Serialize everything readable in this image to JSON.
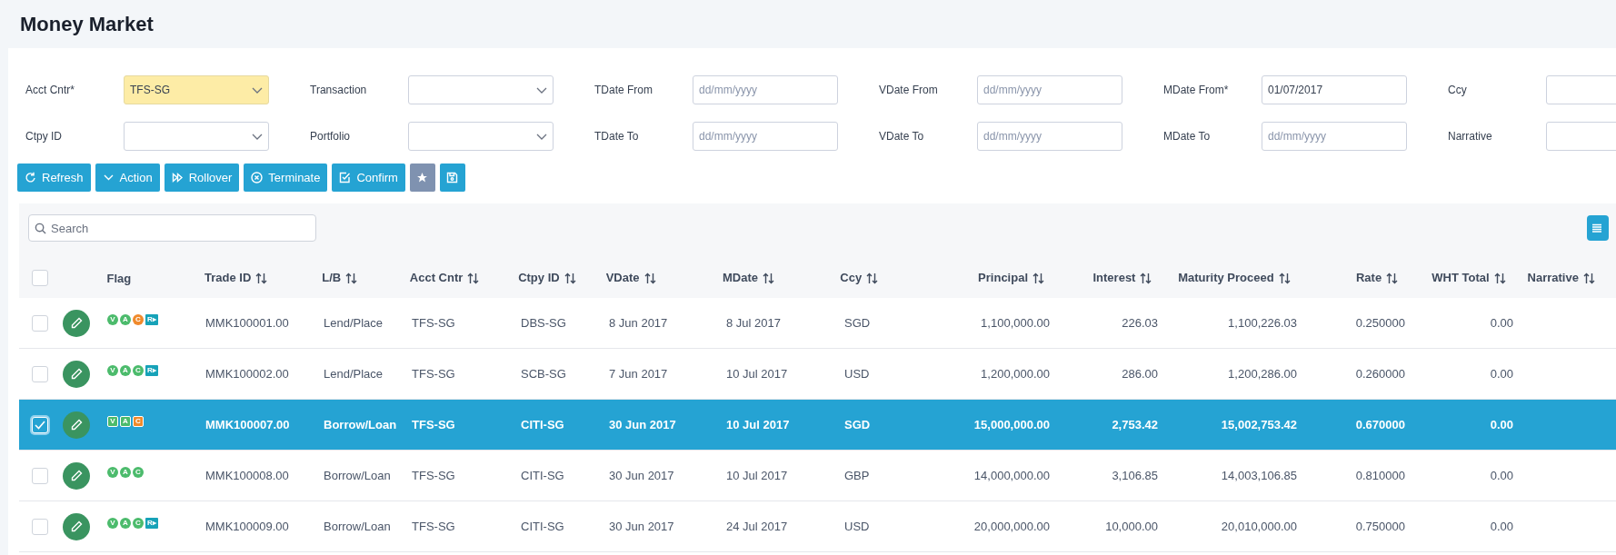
{
  "page_title": "Money Market",
  "filters": [
    {
      "label": "Acct Cntr*",
      "kind": "select",
      "value": "TFS-SG",
      "highlighted": true
    },
    {
      "label": "Transaction",
      "kind": "select",
      "highlighted": false
    },
    {
      "label": "TDate From",
      "kind": "date",
      "placeholder": "dd/mm/yyyy",
      "highlighted": false
    },
    {
      "label": "VDate From",
      "kind": "date",
      "placeholder": "dd/mm/yyyy",
      "highlighted": false
    },
    {
      "label": "MDate From*",
      "kind": "date",
      "value": "01/07/2017",
      "highlighted": false
    },
    {
      "label": "Ccy",
      "kind": "text",
      "highlighted": false
    },
    {
      "label": "Ctpy ID",
      "kind": "select",
      "highlighted": false
    },
    {
      "label": "Portfolio",
      "kind": "select",
      "highlighted": false
    },
    {
      "label": "TDate To",
      "kind": "date",
      "placeholder": "dd/mm/yyyy",
      "highlighted": false
    },
    {
      "label": "VDate To",
      "kind": "date",
      "placeholder": "dd/mm/yyyy",
      "highlighted": false
    },
    {
      "label": "MDate To",
      "kind": "date",
      "placeholder": "dd/mm/yyyy",
      "highlighted": false
    },
    {
      "label": "Narrative",
      "kind": "text",
      "highlighted": false
    }
  ],
  "toolbar": [
    {
      "kind": "refresh",
      "label": "Refresh"
    },
    {
      "kind": "action",
      "label": "Action"
    },
    {
      "kind": "rollover",
      "label": "Rollover"
    },
    {
      "kind": "terminate",
      "label": "Terminate"
    },
    {
      "kind": "confirm",
      "label": "Confirm"
    },
    {
      "kind": "favorite"
    },
    {
      "kind": "save"
    }
  ],
  "search": {
    "placeholder": "Search"
  },
  "table": {
    "all_checked": false,
    "flag_column": "Flag",
    "columns": [
      "Trade ID",
      "L/B",
      "Acct Cntr",
      "Ctpy ID",
      "VDate",
      "MDate",
      "Ccy",
      "Principal",
      "Interest",
      "Maturity Proceed",
      "Rate",
      "WHT Total",
      "Narrative"
    ],
    "rows": [
      {
        "selected": false,
        "checked": false,
        "flags": [
          {
            "kind": "circle",
            "label": "V",
            "color": "#4cbb6c"
          },
          {
            "kind": "circle",
            "label": "A",
            "color": "#4cbb6c"
          },
          {
            "kind": "circle",
            "label": "C",
            "color": "#f08a2c"
          },
          {
            "kind": "square",
            "label": "R▸",
            "color": "#17a2b8"
          }
        ],
        "cells": [
          "MMK100001.00",
          "Lend/Place",
          "TFS-SG",
          "DBS-SG",
          "8 Jun 2017",
          "8 Jul 2017",
          "SGD",
          "1,100,000.00",
          "226.03",
          "1,100,226.03",
          "0.250000",
          "0.00"
        ]
      },
      {
        "selected": false,
        "checked": false,
        "flags": [
          {
            "kind": "circle",
            "label": "V",
            "color": "#4cbb6c"
          },
          {
            "kind": "circle",
            "label": "A",
            "color": "#4cbb6c"
          },
          {
            "kind": "circle",
            "label": "C",
            "color": "#4cbb6c"
          },
          {
            "kind": "square",
            "label": "R▸",
            "color": "#17a2b8"
          }
        ],
        "cells": [
          "MMK100002.00",
          "Lend/Place",
          "TFS-SG",
          "SCB-SG",
          "7 Jun 2017",
          "10 Jul 2017",
          "USD",
          "1,200,000.00",
          "286.00",
          "1,200,286.00",
          "0.260000",
          "0.00"
        ]
      },
      {
        "selected": true,
        "checked": true,
        "flags": [
          {
            "kind": "circle",
            "label": "V",
            "color": "#4cbb6c"
          },
          {
            "kind": "circle",
            "label": "A",
            "color": "#4cbb6c"
          },
          {
            "kind": "circle",
            "label": "C",
            "color": "#f08a2c"
          }
        ],
        "cells": [
          "MMK100007.00",
          "Borrow/Loan",
          "TFS-SG",
          "CITI-SG",
          "30 Jun 2017",
          "10 Jul 2017",
          "SGD",
          "15,000,000.00",
          "2,753.42",
          "15,002,753.42",
          "0.670000",
          "0.00"
        ]
      },
      {
        "selected": false,
        "checked": false,
        "flags": [
          {
            "kind": "circle",
            "label": "V",
            "color": "#4cbb6c"
          },
          {
            "kind": "circle",
            "label": "A",
            "color": "#4cbb6c"
          },
          {
            "kind": "circle",
            "label": "C",
            "color": "#4cbb6c"
          }
        ],
        "cells": [
          "MMK100008.00",
          "Borrow/Loan",
          "TFS-SG",
          "CITI-SG",
          "30 Jun 2017",
          "10 Jul 2017",
          "GBP",
          "14,000,000.00",
          "3,106.85",
          "14,003,106.85",
          "0.810000",
          "0.00"
        ]
      },
      {
        "selected": false,
        "checked": false,
        "flags": [
          {
            "kind": "circle",
            "label": "V",
            "color": "#4cbb6c"
          },
          {
            "kind": "circle",
            "label": "A",
            "color": "#4cbb6c"
          },
          {
            "kind": "circle",
            "label": "C",
            "color": "#4cbb6c"
          },
          {
            "kind": "square",
            "label": "R▸",
            "color": "#17a2b8"
          }
        ],
        "cells": [
          "MMK100009.00",
          "Borrow/Loan",
          "TFS-SG",
          "CITI-SG",
          "30 Jun 2017",
          "24 Jul 2017",
          "USD",
          "20,000,000.00",
          "10,000.00",
          "20,010,000.00",
          "0.750000",
          "0.00"
        ]
      }
    ]
  }
}
